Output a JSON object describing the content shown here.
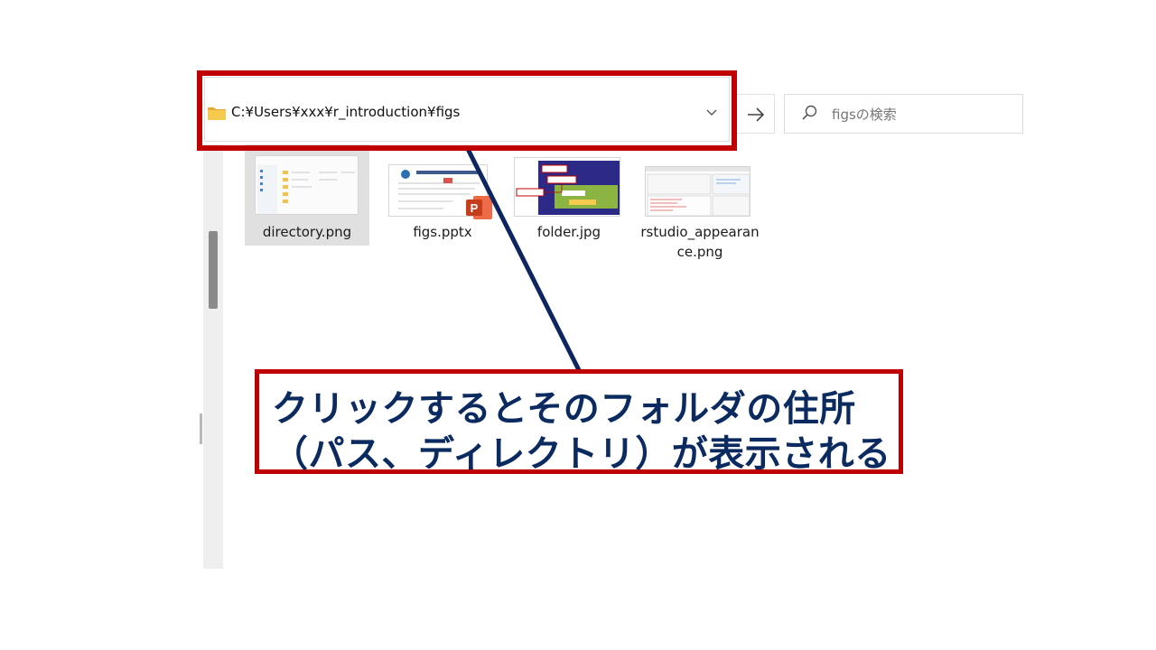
{
  "address_bar": {
    "path": "C:¥Users¥xxx¥r_introduction¥figs",
    "folder_icon": "folder-icon",
    "dropdown_icon": "chevron-down-icon"
  },
  "navigation": {
    "go_icon": "arrow-right-icon"
  },
  "search": {
    "placeholder": "figsの検索",
    "icon": "search-icon"
  },
  "files": [
    {
      "name": "directory.png",
      "selected": true
    },
    {
      "name": "figs.pptx",
      "selected": false
    },
    {
      "name": "folder.jpg",
      "selected": false
    },
    {
      "name": "rstudio_appearan\nce.png",
      "selected": false
    }
  ],
  "callout": {
    "line1": "クリックするとそのフォルダの住所",
    "line2": "（パス、ディレクトリ）が表示される"
  },
  "colors": {
    "highlight": "#c00000",
    "callout_text": "#0b2a5f",
    "pointer_line": "#0d2660",
    "folder": "#f2c14e"
  }
}
